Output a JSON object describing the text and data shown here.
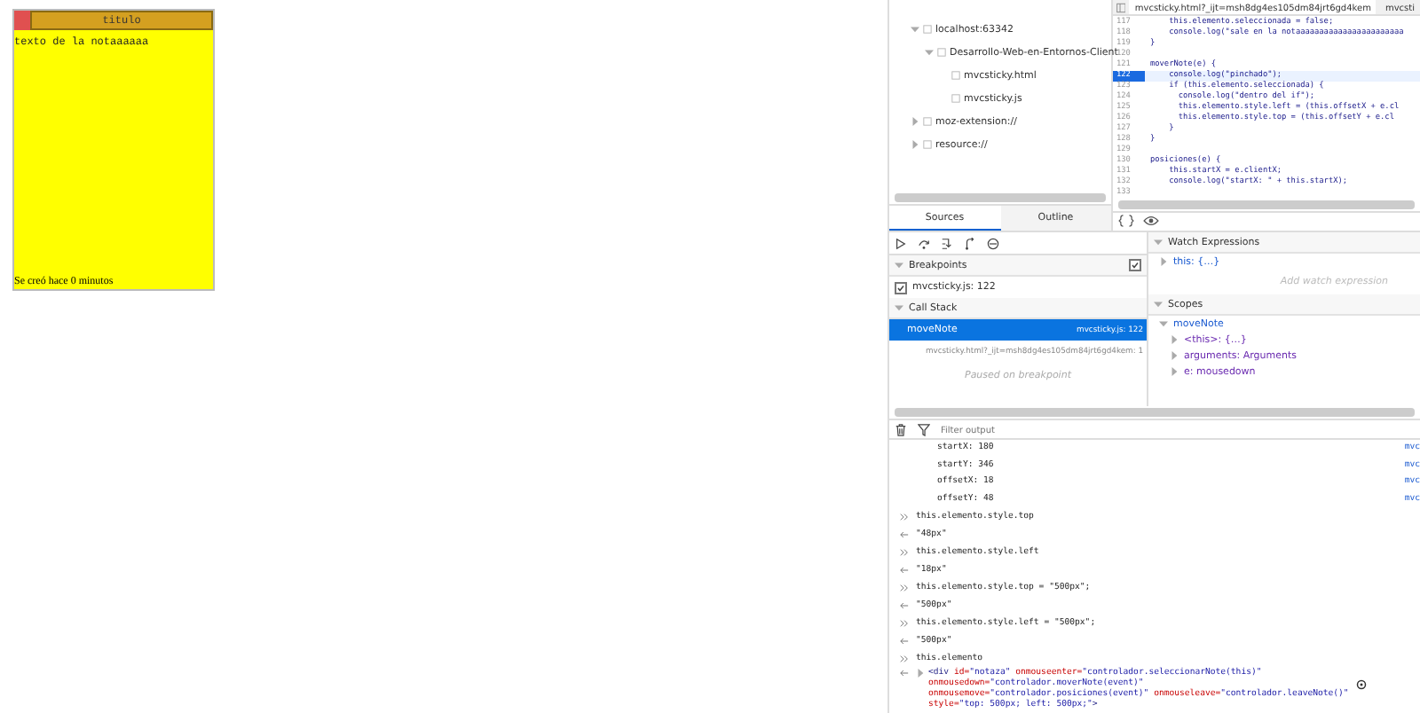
{
  "note": {
    "title": "titulo",
    "body": "texto de la notaaaaaa",
    "footer": "Se creó hace 0 minutos"
  },
  "devtools": {
    "editor_tabs": [
      {
        "label": "mvcsticky.html?_ijt=msh8dg4es105dm84jrt6gd4kem",
        "selected": true
      },
      {
        "label": "mvcsti",
        "selected": false
      }
    ],
    "source_tree": [
      {
        "label": "localhost:63342",
        "expanded": true,
        "children": [
          {
            "label": "Desarrollo-Web-en-Entornos-Client",
            "expanded": true,
            "children": [
              {
                "label": "mvcsticky.html"
              },
              {
                "label": "mvcsticky.js"
              }
            ]
          }
        ]
      },
      {
        "label": "moz-extension://",
        "expanded": false
      },
      {
        "label": "resource://",
        "expanded": false
      }
    ],
    "code_lines": [
      {
        "number": "117",
        "text": "    this.elemento.seleccionada = false;",
        "breakpoint": false
      },
      {
        "number": "118",
        "text": "    console.log(\"sale en la notaaaaaaaaaaaaaaaaaaaaaaa",
        "breakpoint": false
      },
      {
        "number": "119",
        "text": "}",
        "breakpoint": false
      },
      {
        "number": "120",
        "breakpoint": false
      },
      {
        "number": "121",
        "text": "moverNote(e) {",
        "breakpoint": false
      },
      {
        "number": "122",
        "text": "    console.log(\"pinchado\");",
        "breakpoint": true
      },
      {
        "number": "123",
        "text": "    if (this.elemento.seleccionada) {",
        "breakpoint": false
      },
      {
        "number": "124",
        "text": "      console.log(\"dentro del if\");",
        "breakpoint": false
      },
      {
        "number": "125",
        "text": "      this.elemento.style.left = (this.offsetX + e.cl",
        "breakpoint": false
      },
      {
        "number": "126",
        "text": "      this.elemento.style.top = (this.offsetY + e.cl",
        "breakpoint": false
      },
      {
        "number": "127",
        "text": "    }",
        "breakpoint": false
      },
      {
        "number": "128",
        "text": "}",
        "breakpoint": false
      },
      {
        "number": "129",
        "breakpoint": false
      },
      {
        "number": "130",
        "text": "posiciones(e) {",
        "breakpoint": false
      },
      {
        "number": "131",
        "text": "    this.startX = e.clientX;",
        "breakpoint": false
      },
      {
        "number": "132",
        "text": "    console.log(\"startX: \" + this.startX);",
        "breakpoint": false
      },
      {
        "number": "133",
        "breakpoint": false
      }
    ],
    "side_tabs": [
      {
        "label": "Sources",
        "selected": true
      },
      {
        "label": "Outline",
        "selected": false
      }
    ],
    "breakpoints": {
      "title": "Breakpoints",
      "pause_all": true,
      "items": [
        {
          "label": "mvcsticky.js: 122",
          "checked": true
        }
      ]
    },
    "call_stack": {
      "title": "Call Stack",
      "frames": [
        {
          "name": "moveNote",
          "location": "mvcsticky.js: 122",
          "selected": true
        },
        {
          "location": "mvcsticky.html?_ijt=msh8dg4es105dm84jrt6gd4kem: 1",
          "selected": false
        }
      ],
      "status": "Paused on breakpoint"
    },
    "watch": {
      "title": "Watch Expressions",
      "items": [
        "this: {…}"
      ],
      "placeholder": "Add watch expression"
    },
    "scopes": {
      "title": "Scopes",
      "frame": "moveNote",
      "items": [
        "<this>: {…}",
        "arguments: Arguments",
        "e: mousedown"
      ]
    },
    "console": {
      "filter_placeholder": "Filter output",
      "entries": [
        {
          "kind": "log",
          "text": "startX: 180",
          "source": "mvc"
        },
        {
          "kind": "log",
          "text": "startY: 346",
          "source": "mvc"
        },
        {
          "kind": "log",
          "text": "offsetX: 18",
          "source": "mvc"
        },
        {
          "kind": "log",
          "text": "offsetY: 48",
          "source": "mvc"
        },
        {
          "kind": "input",
          "text": "this.elemento.style.top"
        },
        {
          "kind": "output",
          "text": "\"48px\""
        },
        {
          "kind": "input",
          "text": "this.elemento.style.left"
        },
        {
          "kind": "output",
          "text": "\"18px\""
        },
        {
          "kind": "input",
          "text": "this.elemento.style.top = \"500px\";"
        },
        {
          "kind": "output",
          "text": "\"500px\""
        },
        {
          "kind": "input",
          "text": "this.elemento.style.left = \"500px\";"
        },
        {
          "kind": "output",
          "text": "\"500px\""
        },
        {
          "kind": "input",
          "text": "this.elemento"
        },
        {
          "kind": "element",
          "segments": [
            {
              "kind": "tag",
              "text": "<div"
            },
            {
              "kind": "attr",
              "text": " id="
            },
            {
              "kind": "value",
              "text": "\"notaza\""
            },
            {
              "kind": "attr",
              "text": " onmouseenter="
            },
            {
              "kind": "value",
              "text": "\"controlador.seleccionarNote(this)\""
            },
            {
              "kind": "attr",
              "text": " onmousedown="
            },
            {
              "kind": "value",
              "text": "\"controlador.moverNote(event)\""
            },
            {
              "kind": "attr",
              "text": " onmousemove="
            },
            {
              "kind": "value",
              "text": "\"controlador.posiciones(event)\""
            },
            {
              "kind": "attr",
              "text": " onmouseleave="
            },
            {
              "kind": "value",
              "text": "\"controlador.leaveNote()\""
            },
            {
              "kind": "attr",
              "text": " style="
            },
            {
              "kind": "value",
              "text": "\"top: 500px; left: 500px;\""
            },
            {
              "kind": "tag",
              "text": ">"
            }
          ]
        }
      ]
    }
  }
}
